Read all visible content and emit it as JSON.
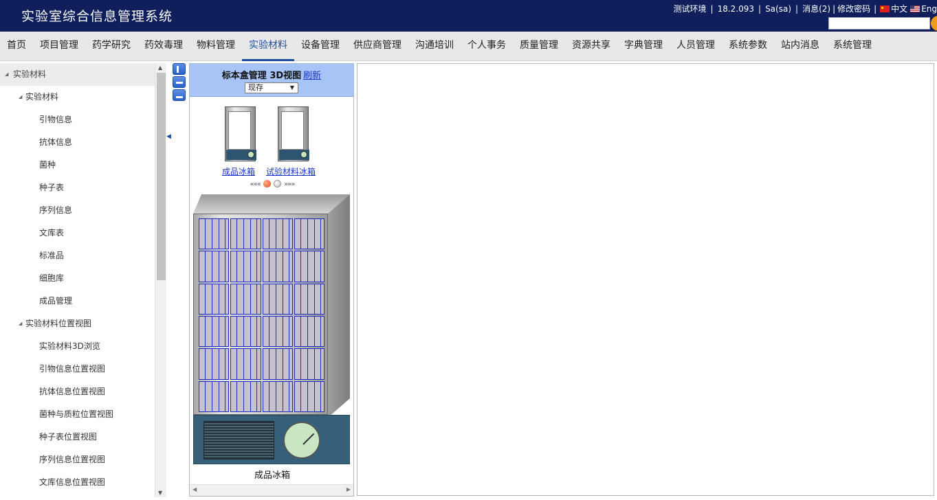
{
  "header": {
    "title": "实验室综合信息管理系统",
    "env": "测试环境",
    "version": "18.2.093",
    "user": "Sa(sa)",
    "messages": "消息(2)",
    "change_password": "修改密码",
    "lang_cn": "中文",
    "lang_en": "Eng",
    "search_placeholder": ""
  },
  "nav": {
    "items": [
      "首页",
      "项目管理",
      "药学研究",
      "药效毒理",
      "物料管理",
      "实验材料",
      "设备管理",
      "供应商管理",
      "沟通培训",
      "个人事务",
      "质量管理",
      "资源共享",
      "字典管理",
      "人员管理",
      "系统参数",
      "站内消息",
      "系统管理"
    ],
    "active": "实验材料"
  },
  "sidebar": {
    "root": "实验材料",
    "groups": [
      {
        "label": "实验材料",
        "items": [
          "引物信息",
          "抗体信息",
          "菌种",
          "种子表",
          "序列信息",
          "文库表",
          "标准品",
          "细胞库",
          "成品管理"
        ]
      },
      {
        "label": "实验材料位置视图",
        "items": [
          "实验材料3D浏览",
          "引物信息位置视图",
          "抗体信息位置视图",
          "菌种与质粒位置视图",
          "种子表位置视图",
          "序列信息位置视图",
          "文库信息位置视图"
        ]
      }
    ]
  },
  "panel": {
    "title": "标本盒管理 3D视图",
    "refresh": "刷新",
    "status_value": "现存",
    "thumbnails": [
      "成品冰箱",
      "试验材料冰箱"
    ],
    "pager_prev": "«««",
    "pager_next": "»»»",
    "current_page": 1,
    "page_count": 2,
    "fridge_caption": "成品冰箱"
  },
  "colors": {
    "header_bg": "#0f1f5c",
    "nav_active": "#1b4fa0",
    "panel_head": "#a7c4f7",
    "rack_line": "#1c2bbf"
  }
}
